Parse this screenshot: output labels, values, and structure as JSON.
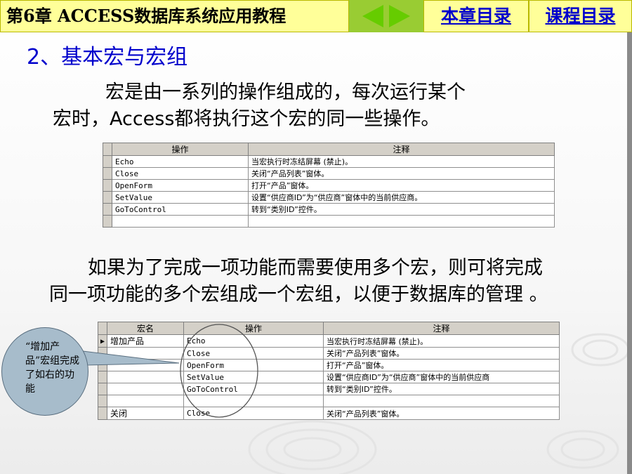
{
  "header": {
    "title": "第6章 ACCESS数据库系统应用教程",
    "link_chapter": "本章目录",
    "link_course": "课程目录"
  },
  "heading": "2、基本宏与宏组",
  "para1": {
    "line1": "宏是由一系列的操作组成的，每次运行某个",
    "line2": "宏时，Access都将执行这个宏的同一些操作。"
  },
  "grid1": {
    "columns": [
      "操作",
      "注释"
    ],
    "rows": [
      [
        "Echo",
        "当宏执行时冻结屏幕 (禁止)。"
      ],
      [
        "Close",
        "关闭“产品列表”窗体。"
      ],
      [
        "OpenForm",
        "打开“产品”窗体。"
      ],
      [
        "SetValue",
        "设置“供应商ID”为“供应商”窗体中的当前供应商。"
      ],
      [
        "GoToControl",
        "转到“类别ID”控件。"
      ],
      [
        "",
        ""
      ]
    ]
  },
  "para2": {
    "line1": "如果为了完成一项功能而需要使用多个宏，则可将完成",
    "line2": "同一项功能的多个宏组成一个宏组，以便于数据库的管理 。"
  },
  "grid2": {
    "columns": [
      "宏名",
      "操作",
      "注释"
    ],
    "rows": [
      [
        "增加产品",
        "Echo",
        "当宏执行时冻结屏幕 (禁止)。"
      ],
      [
        "",
        "Close",
        "关闭“产品列表”窗体。"
      ],
      [
        "",
        "OpenForm",
        "打开“产品”窗体。"
      ],
      [
        "",
        "SetValue",
        "设置“供应商ID”为“供应商”窗体中的当前供应商"
      ],
      [
        "",
        "GoToControl",
        "转到“类别ID”控件。"
      ],
      [
        "",
        "",
        ""
      ],
      [
        "关闭",
        "Close",
        "关闭“产品列表”窗体。"
      ]
    ]
  },
  "callout": {
    "text": "“增加产品”宏组完成了如右的功能"
  }
}
